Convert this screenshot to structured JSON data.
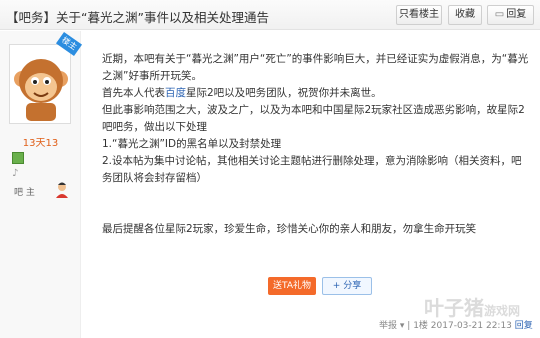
{
  "header": {
    "title": "【吧务】关于“暮光之渊”事件以及相关处理通告",
    "btn_only_owner": "只看楼主",
    "btn_favorite": "收藏",
    "btn_reply": "回复",
    "reply_icon": "reply-icon"
  },
  "author": {
    "corner_badge": "楼主",
    "username": "13天13",
    "role": "吧 主",
    "avatar_icon": "monkey-avatar",
    "colors": {
      "username": "#e0601a",
      "badge": "#2b8de0"
    }
  },
  "post": {
    "lines": [
      "近期，本吧有关于“暮光之渊”用户“死亡”的事件影响巨大，并已经证实为虚假消息，为“暮光",
      "之渊”好事所开玩笑。",
      "但此事影响范围之大，波及之广，以及为本吧和中国星际2玩家社区造成恶劣影响，故星际2",
      "吧吧务，做出以下处理",
      "1.“暮光之渊”ID的黑名单以及封禁处理",
      "2.设本帖为集中讨论帖，其他相关讨论主题帖进行删除处理，意为消除影响（相关资料，吧",
      "务团队将会封存留档）",
      "最后提醒各位星际2玩家，珍爱生命，珍惜关心你的亲人和朋友，勿拿生命开玩笑"
    ],
    "line_mixed": {
      "before": "首先本人代表",
      "link": "百度",
      "after": "星际2吧以及吧务团队，祝贺你并未离世。"
    }
  },
  "actions": {
    "gift": "送TA礼物",
    "share": "分享",
    "colors": {
      "gift": "#f46a2a",
      "link": "#2d64b3"
    }
  },
  "footer": {
    "report": "举报",
    "floor": "1楼",
    "time": "2017-03-21 22:13",
    "reply": "回复"
  },
  "watermark": {
    "main": "叶子猪",
    "sub": "游戏网"
  }
}
